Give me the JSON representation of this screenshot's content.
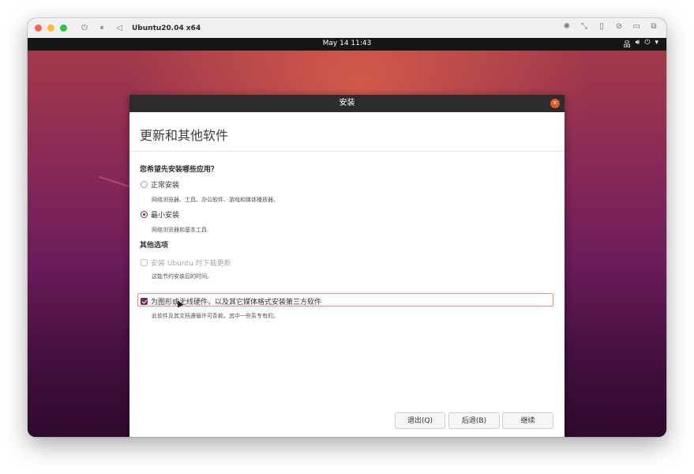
{
  "mac_window": {
    "title": "Ubuntu20.04 x64",
    "left_icons": [
      "power-icon",
      "pause-icon",
      "back-icon"
    ],
    "right_icons": [
      "brightness-icon",
      "resize-icon",
      "mouse-icon",
      "no-sound-icon",
      "folder-icon",
      "windows-icon"
    ]
  },
  "ubuntu_topbar": {
    "clock": "May 14  11:43",
    "tray_icons": [
      "network-icon",
      "volume-icon",
      "power-icon",
      "chevron-down-icon"
    ]
  },
  "dialog": {
    "title": "安装",
    "page_title": "更新和其他软件",
    "question": "您希望先安装哪些应用？",
    "options": [
      {
        "label": "正常安装",
        "description": "网络浏览器、工具、办公软件、游戏和媒体播放器。",
        "checked": false
      },
      {
        "label": "最小安装",
        "description": "网络浏览器和基本工具",
        "checked": true
      }
    ],
    "other_section": "其他选项",
    "checkboxes": [
      {
        "label": "安装 Ubuntu 时下载更新",
        "description": "这能节约安装后的时间。",
        "checked": false,
        "enabled": false
      },
      {
        "label": "为图形或无线硬件，以及其它媒体格式安装第三方软件",
        "description": "此软件及其文档遵循许可条款。其中一些系专有的。",
        "checked": true,
        "enabled": true
      }
    ],
    "buttons": {
      "quit": "退出(Q)",
      "back": "后退(B)",
      "continue": "继续"
    },
    "progress": {
      "filled": 4,
      "total": 7
    },
    "accent_color": "#772953",
    "close_color": "#e95420"
  }
}
